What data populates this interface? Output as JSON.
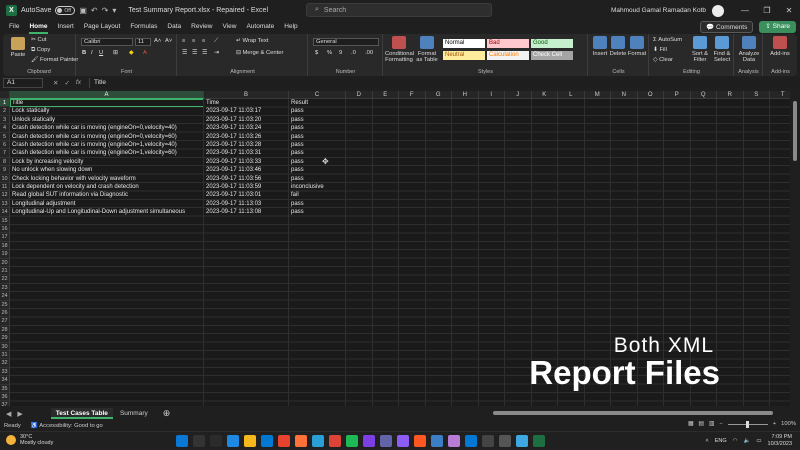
{
  "window": {
    "autosave_label": "AutoSave",
    "autosave_state": "Off",
    "title": "Test Summary Report.xlsx  -  Repaired  -  Excel",
    "search_placeholder": "Search",
    "user_name": "Mahmoud Gamal Ramadan Kotb"
  },
  "menu": {
    "tabs": [
      "File",
      "Home",
      "Insert",
      "Page Layout",
      "Formulas",
      "Data",
      "Review",
      "View",
      "Automate",
      "Help"
    ],
    "active_tab": "Home",
    "comments_label": "Comments",
    "share_label": "Share"
  },
  "ribbon": {
    "clipboard": {
      "label": "Clipboard",
      "paste": "Paste",
      "cut": "Cut",
      "copy": "Copy",
      "format_painter": "Format Painter"
    },
    "font": {
      "label": "Font",
      "family": "Calibri",
      "size": "11"
    },
    "alignment": {
      "label": "Alignment",
      "wrap_text": "Wrap Text",
      "merge_center": "Merge & Center"
    },
    "number": {
      "label": "Number",
      "format": "General"
    },
    "styles": {
      "label": "Styles",
      "conditional_formatting": "Conditional Formatting",
      "format_as_table": "Format as Table",
      "cells": [
        {
          "name": "Normal",
          "bg": "#ffffff",
          "fg": "#000000"
        },
        {
          "name": "Bad",
          "bg": "#ffc7ce",
          "fg": "#9c0006"
        },
        {
          "name": "Good",
          "bg": "#c6efce",
          "fg": "#006100"
        },
        {
          "name": "Neutral",
          "bg": "#ffeb9c",
          "fg": "#9c5700"
        },
        {
          "name": "Calculation",
          "bg": "#f2f2f2",
          "fg": "#fa7d00"
        },
        {
          "name": "Check Cell",
          "bg": "#a5a5a5",
          "fg": "#ffffff"
        }
      ]
    },
    "cells": {
      "label": "Cells",
      "insert": "Insert",
      "delete": "Delete",
      "format": "Format"
    },
    "editing": {
      "label": "Editing",
      "autosum": "AutoSum",
      "fill": "Fill",
      "clear": "Clear",
      "sort_filter": "Sort & Filter",
      "find_select": "Find & Select"
    },
    "analysis": {
      "label": "Analysis",
      "analyze_data": "Analyze Data"
    },
    "addins": {
      "label": "Add-ins",
      "addins": "Add-ins"
    }
  },
  "formula_bar": {
    "name_box": "A1",
    "fx": "fx",
    "content": "Title"
  },
  "grid": {
    "columns": [
      "A",
      "B",
      "C",
      "D",
      "E",
      "F",
      "G",
      "H",
      "I",
      "J",
      "K",
      "L",
      "M",
      "N",
      "O",
      "P",
      "Q",
      "R",
      "S",
      "T"
    ],
    "row_count": 38,
    "header_row": [
      "Title",
      "Time",
      "Result"
    ],
    "rows": [
      [
        "Lock statically",
        "2023-09-17 11:03:17",
        "pass"
      ],
      [
        "Unlock statically",
        "2023-09-17 11:03:20",
        "pass"
      ],
      [
        "Crash detection while car is moving (engineOn=0,velocity=40)",
        "2023-09-17 11:03:24",
        "pass"
      ],
      [
        "Crash detection while car is moving (engineOn=0,velocity=60)",
        "2023-09-17 11:03:26",
        "pass"
      ],
      [
        "Crash detection while car is moving (engineOn=1,velocity=40)",
        "2023-09-17 11:03:28",
        "pass"
      ],
      [
        "Crash detection while car is moving (engineOn=1,velocity=60)",
        "2023-09-17 11:03:31",
        "pass"
      ],
      [
        "Lock by increasing velocity",
        "2023-09-17 11:03:33",
        "pass"
      ],
      [
        "No unlock when slowing down",
        "2023-09-17 11:03:46",
        "pass"
      ],
      [
        "Check locking behavior with velocity waveform",
        "2023-09-17 11:03:56",
        "pass"
      ],
      [
        "Lock dependent on velocity and crash detection",
        "2023-09-17 11:03:59",
        "inconclusive"
      ],
      [
        "Read global SUT information via Diagnostic",
        "2023-09-17 11:03:01",
        "fail"
      ],
      [
        "Longitudinal adjustment",
        "2023-09-17 11:13:03",
        "pass"
      ],
      [
        "Longitudinal-Up and Longitudinal-Down adjustment simultaneous",
        "2023-09-17 11:13:08",
        "pass"
      ]
    ]
  },
  "overlay": {
    "line1": "Both XML",
    "line2": "Report Files"
  },
  "sheets": {
    "tabs": [
      "Test Cases Table",
      "Summary"
    ],
    "active": "Test Cases Table"
  },
  "status": {
    "ready": "Ready",
    "accessibility": "Accessibility: Good to go",
    "zoom": "100%"
  },
  "taskbar": {
    "temperature": "30°C",
    "weather": "Mostly cloudy",
    "language": "ENG",
    "time": "7:09 PM",
    "date": "10/3/2023",
    "app_colors": [
      "#0a78d4",
      "#333333",
      "#2b2b2b",
      "#1e88e5",
      "#f6b81d",
      "#0078d4",
      "#e8432e",
      "#ff7139",
      "#2a9fd6",
      "#db4437",
      "#1db954",
      "#7b3fe4",
      "#6264a7",
      "#8b5cf6",
      "#ff5722",
      "#3c7fc5",
      "#b87cd6",
      "#0078d4",
      "#444444",
      "#555555",
      "#3da9e0",
      "#1d6f42"
    ]
  }
}
